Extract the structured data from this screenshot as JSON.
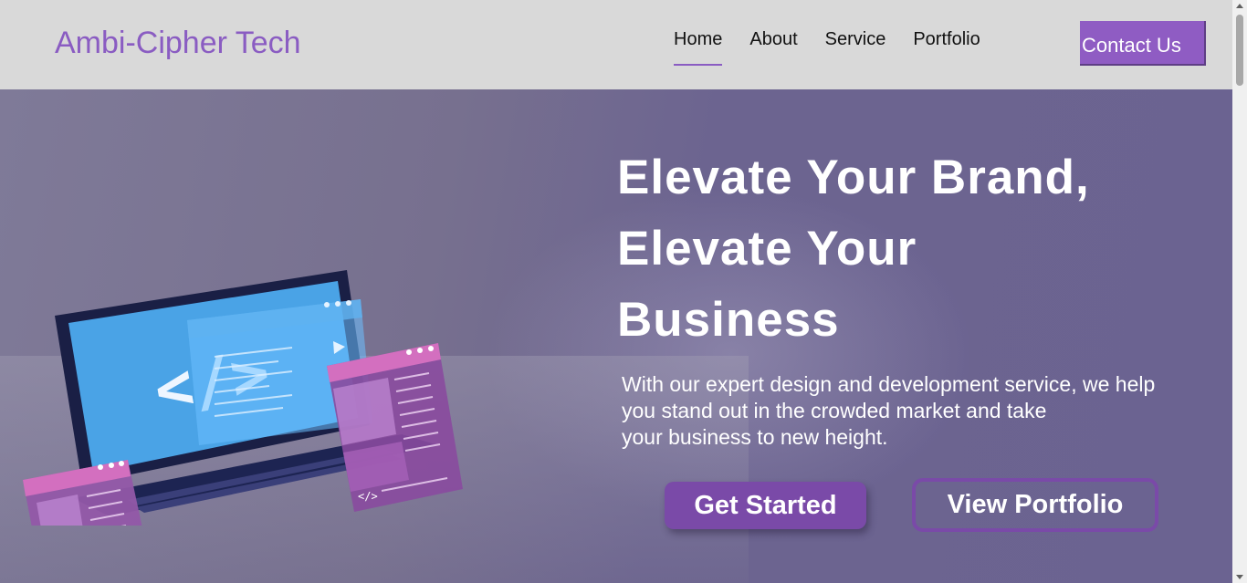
{
  "header": {
    "brand": "Ambi-Cipher Tech",
    "nav": [
      "Home",
      "About",
      "Service",
      "Portfolio"
    ],
    "active": "Home",
    "contact_label": "Contact Us"
  },
  "hero": {
    "title_lines": [
      "Elevate Your Brand,",
      "Elevate Your",
      "Business"
    ],
    "desc_lines": [
      "With our expert design and development service, we help",
      "you stand out in the crowded market and take",
      "your business to new height."
    ],
    "primary_button": "Get Started",
    "secondary_button": "View Portfolio",
    "illustration_code_glyph": "</>"
  },
  "colors": {
    "accent": "#8a5cc2",
    "button": "#7a4aa8",
    "navbar_bg": "#d9d9d9",
    "hero_bg": "#6d6690"
  }
}
